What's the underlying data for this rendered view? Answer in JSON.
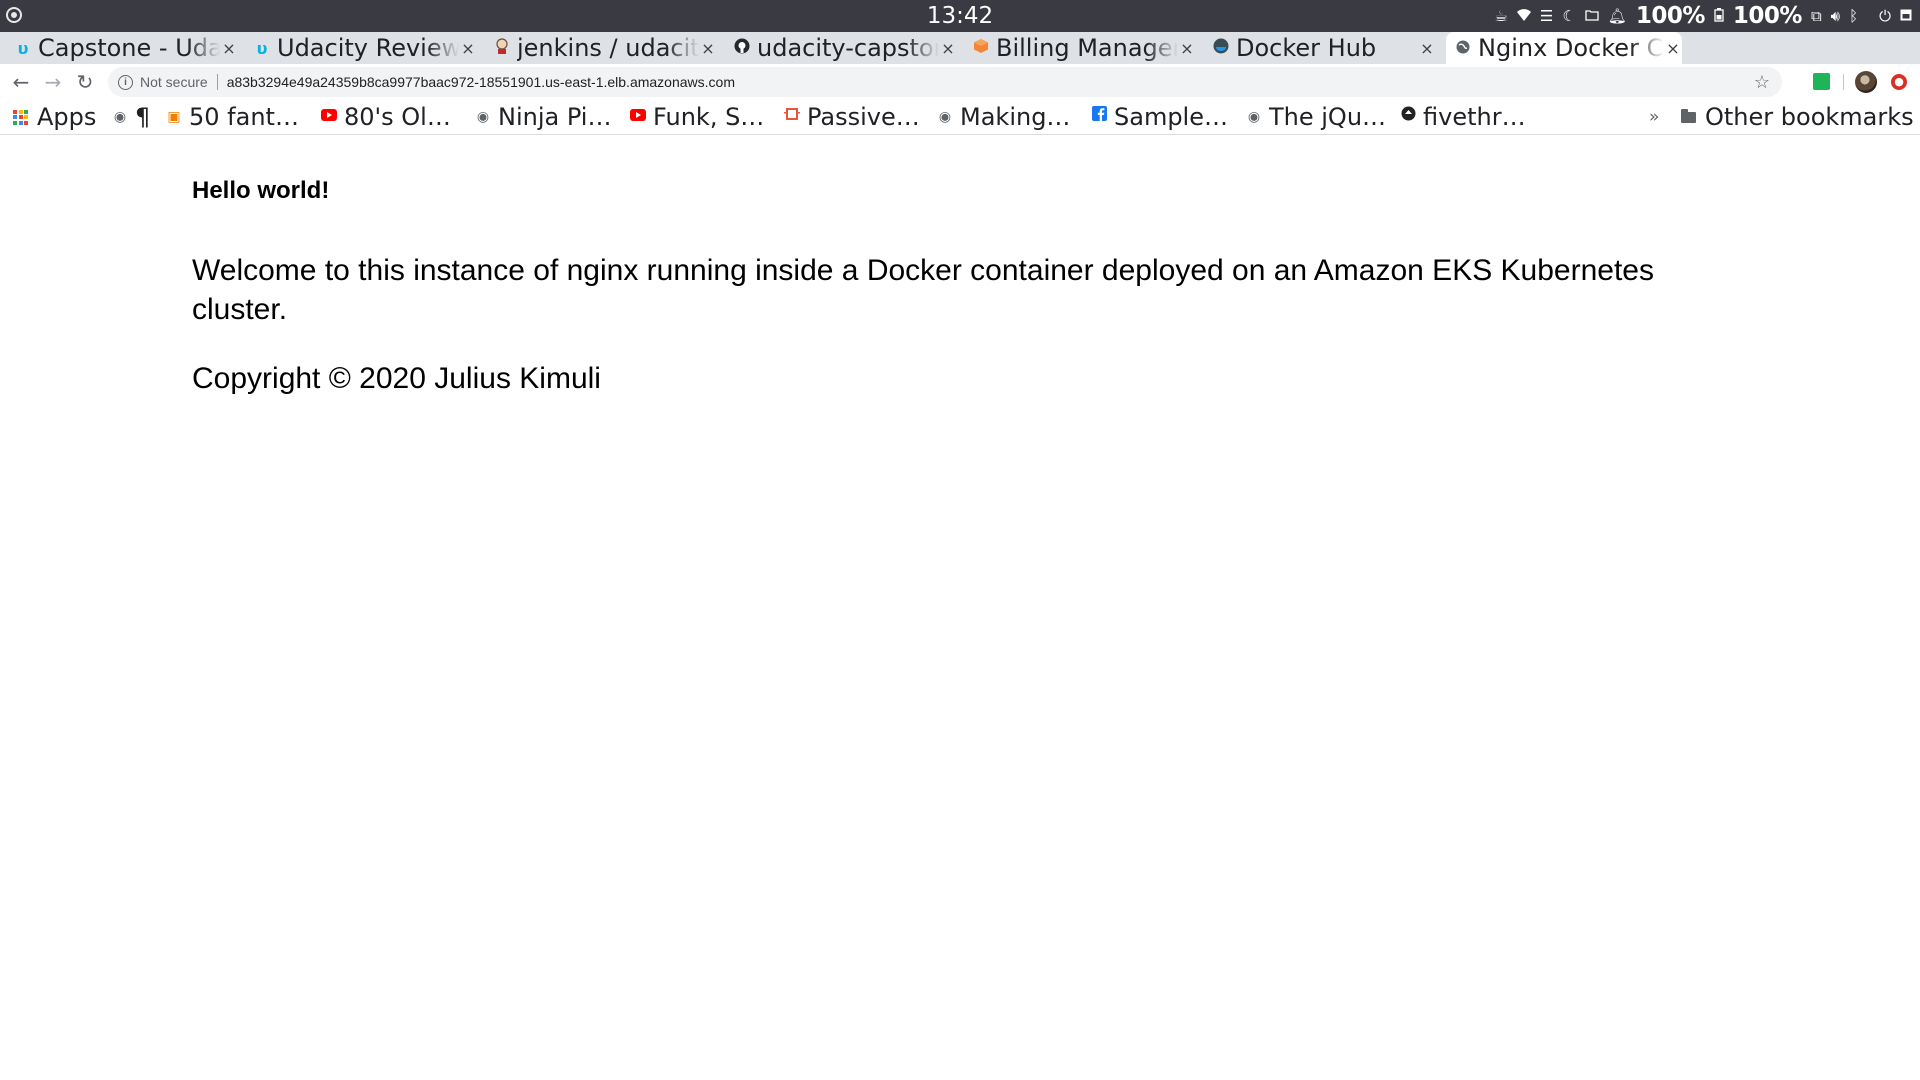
{
  "system": {
    "clock": "13:42",
    "battery_1": "100%",
    "battery_2": "100%"
  },
  "tabs": [
    {
      "title": "Capstone - Udacity",
      "favicon": "udacity-icon"
    },
    {
      "title": "Udacity Reviews",
      "favicon": "udacity-icon"
    },
    {
      "title": "jenkins / udacity",
      "favicon": "jenkins-icon"
    },
    {
      "title": "udacity-capstone",
      "favicon": "github-icon"
    },
    {
      "title": "Billing Management",
      "favicon": "aws-icon"
    },
    {
      "title": "Docker Hub",
      "favicon": "docker-icon"
    },
    {
      "title": "Nginx Docker Container",
      "favicon": "globe-icon",
      "active": true
    }
  ],
  "omnibox": {
    "security_label": "Not secure",
    "url": "a83b3294e49a24359b8ca9977baac972-18551901.us-east-1.elb.amazonaws.com"
  },
  "bookmarks": {
    "apps": "Apps",
    "items": [
      {
        "label": "¶",
        "icon": "globe-icon"
      },
      {
        "label": "50 fant…",
        "icon": "blogger-icon"
      },
      {
        "label": "80's Ol…",
        "icon": "youtube-icon"
      },
      {
        "label": "Ninja Pi…",
        "icon": "globe-icon"
      },
      {
        "label": "Funk, S…",
        "icon": "youtube-icon"
      },
      {
        "label": "Passive…",
        "icon": "chip-icon"
      },
      {
        "label": "Making…",
        "icon": "globe-icon"
      },
      {
        "label": "Sample…",
        "icon": "facebook-icon"
      },
      {
        "label": "The jQu…",
        "icon": "globe-icon"
      },
      {
        "label": "fivethr…",
        "icon": "fivethirtyeight-icon"
      }
    ],
    "more": "»",
    "other": "Other bookmarks"
  },
  "page": {
    "heading": "Hello world!",
    "welcome": "Welcome to this instance of nginx running inside a Docker container deployed on an Amazon EKS Kubernetes cluster.",
    "copyright": "Copyright © 2020 Julius Kimuli"
  },
  "colors": {
    "udacity": "#02b3e4",
    "youtube": "#ff0000",
    "blogger": "#f57d00",
    "facebook": "#1877f2",
    "aws": "#f58536",
    "docker": "#2496ed"
  }
}
